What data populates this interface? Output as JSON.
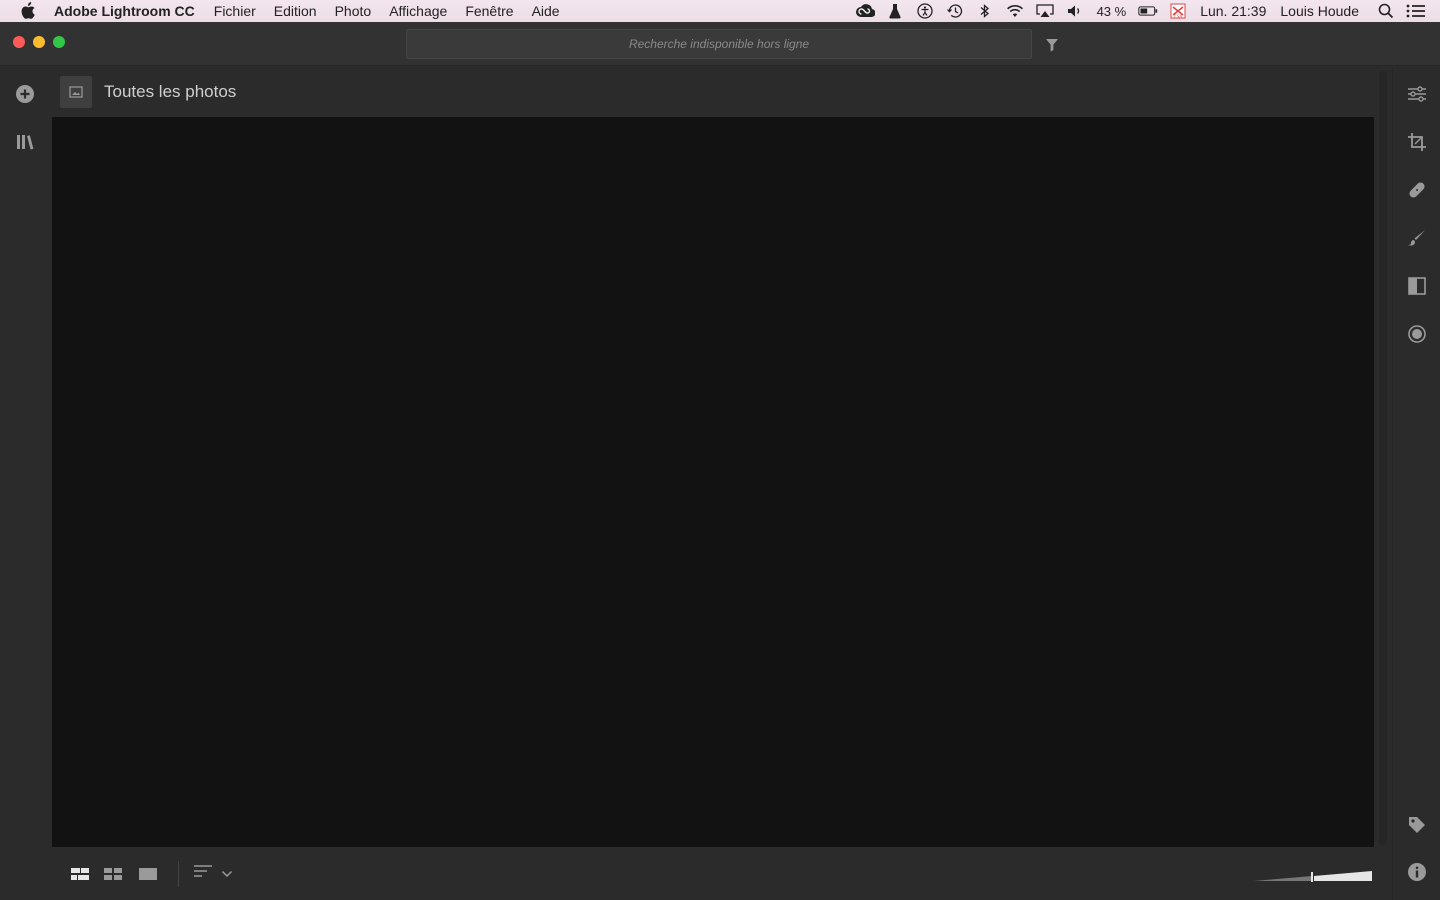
{
  "menubar": {
    "app_name": "Adobe Lightroom CC",
    "menus": [
      "Fichier",
      "Edition",
      "Photo",
      "Affichage",
      "Fenêtre",
      "Aide"
    ],
    "battery_percent": "43 %",
    "clock": "Lun. 21:39",
    "user": "Louis Houde"
  },
  "toolbar": {
    "search_placeholder": "Recherche indisponible hors ligne"
  },
  "album": {
    "title": "Toutes les photos"
  },
  "colors": {
    "accent_close": "#fc5b57",
    "accent_minimize": "#fcbc2e",
    "accent_maximize": "#33c748",
    "panel_bg": "#2b2b2b",
    "grid_bg": "#121212"
  },
  "icons": {
    "left_rail": [
      "add-photos-icon",
      "library-icon"
    ],
    "right_rail": [
      "edit-sliders-icon",
      "crop-icon",
      "healing-icon",
      "brush-icon",
      "linear-gradient-icon",
      "radial-gradient-icon",
      "tag-icon",
      "info-icon"
    ],
    "bottom": [
      "square-grid-view-icon",
      "photo-grid-view-icon",
      "detail-view-icon",
      "sort-icon",
      "chevron-down-icon",
      "thumbnail-size-slider"
    ]
  }
}
